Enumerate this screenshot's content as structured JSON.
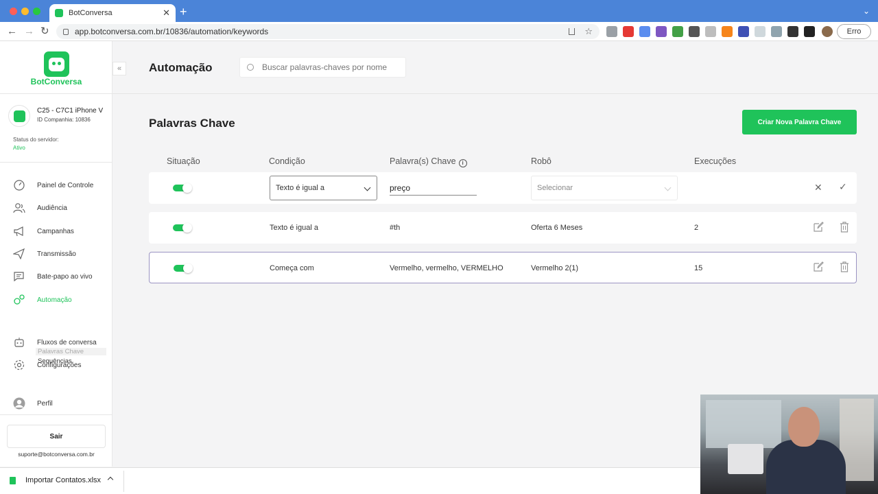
{
  "browser": {
    "tab_title": "BotConversa",
    "url": "app.botconversa.com.br/10836/automation/keywords",
    "profile_button": "Erro",
    "colors": {
      "tabbar": "#4b84d8"
    }
  },
  "brand": {
    "name": "BotConversa",
    "accent": "#1fc35a"
  },
  "company": {
    "name": "C25 - C7C1 iPhone V",
    "id": "ID Companhia: 10836",
    "server_label": "Status do servidor:",
    "server_status": "Ativo"
  },
  "sidebar": {
    "items": [
      {
        "label": "Painel de Controle",
        "icon": "dashboard-icon"
      },
      {
        "label": "Audiência",
        "icon": "users-icon"
      },
      {
        "label": "Campanhas",
        "icon": "megaphone-icon"
      },
      {
        "label": "Transmissão",
        "icon": "send-icon"
      },
      {
        "label": "Bate-papo ao vivo",
        "icon": "chat-icon"
      },
      {
        "label": "Automação",
        "icon": "gears-icon"
      },
      {
        "label": "Fluxos de conversa",
        "icon": "robot-icon"
      },
      {
        "label": "Configurações",
        "icon": "gear-icon"
      }
    ],
    "sub_items": [
      "Palavras Chave",
      "Sequências"
    ],
    "profile": "Perfil",
    "logout": "Sair",
    "support_email": "suporte@botconversa.com.br"
  },
  "header": {
    "title": "Automação",
    "search_placeholder": "Buscar palavras-chaves por nome"
  },
  "keywords": {
    "section_title": "Palavras Chave",
    "create_button": "Criar Nova Palavra Chave",
    "columns": [
      "Situação",
      "Condição",
      "Palavra(s) Chave",
      "Robô",
      "Execuções"
    ],
    "edit_row": {
      "enabled": true,
      "condition": "Texto é igual a",
      "keyword": "preço",
      "bot_placeholder": "Selecionar"
    },
    "rows": [
      {
        "enabled": true,
        "condition": "Texto é igual a",
        "keywords": "#th",
        "bot": "Oferta 6 Meses",
        "executions": "2"
      },
      {
        "enabled": true,
        "condition": "Começa com",
        "keywords": "Vermelho, vermelho, VERMELHO",
        "bot": "Vermelho 2(1)",
        "executions": "15"
      }
    ]
  },
  "downloads": {
    "file": "Importar Contatos.xlsx"
  }
}
